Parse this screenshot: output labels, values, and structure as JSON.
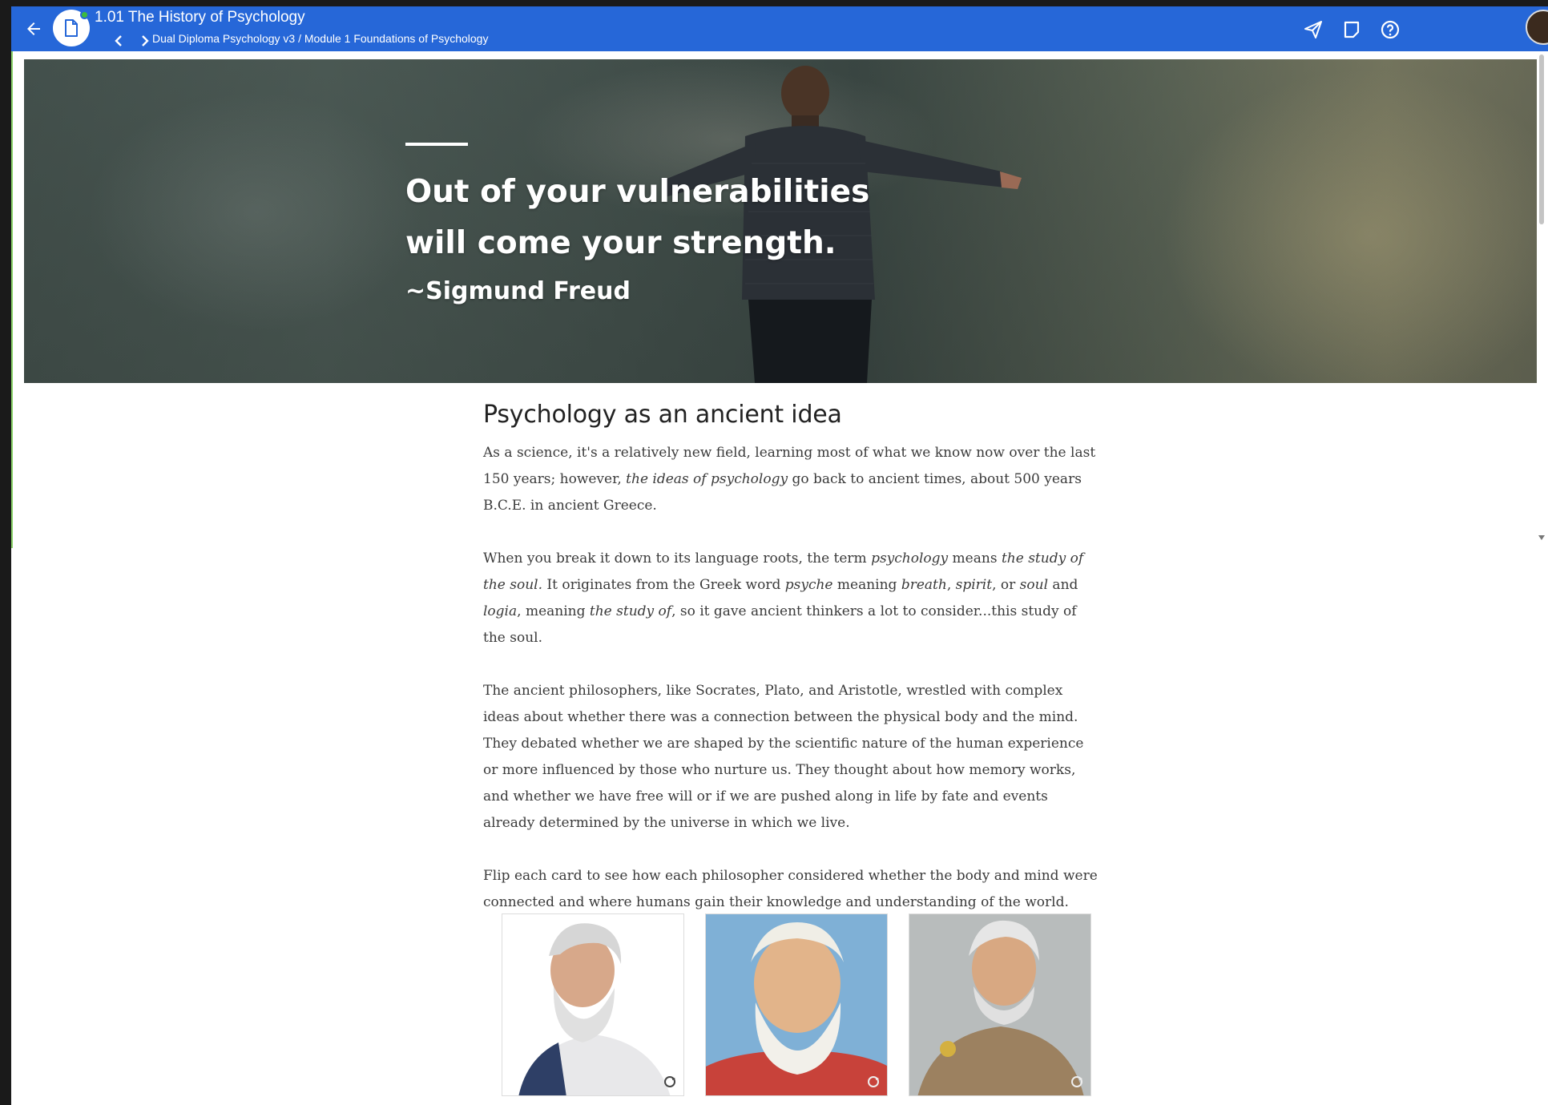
{
  "topbar": {
    "title": "1.01 The History of Psychology",
    "breadcrumb": "Dual Diploma Psychology v3 / Module 1 Foundations of Psychology",
    "accent_color": "#2667d8",
    "icons": [
      "arrow-left-icon",
      "document-icon",
      "chevron-left-icon",
      "chevron-right-icon",
      "send-icon",
      "notes-icon",
      "help-icon"
    ]
  },
  "hero": {
    "quote_line1": "Out of your vulnerabilities",
    "quote_line2": "will come your strength.",
    "author": "~Sigmund Freud"
  },
  "article": {
    "heading": "Psychology as an ancient idea",
    "p1": {
      "a": "As a science, it's a relatively new field, learning most of what we know now over the last 150 years; however, ",
      "b": "the ideas of psychology",
      "c": " go back to ancient times, about 500 years B.C.E. in ancient Greece."
    },
    "p2": {
      "a": "When you break it down to its language roots, the term ",
      "b": "psychology",
      "c": " means ",
      "d": "the study of the soul.",
      "e": "  It originates from the Greek word ",
      "f": "psyche",
      "g": " meaning ",
      "h": "breath",
      "i": ", ",
      "j": "spirit",
      "k": ", or ",
      "l": "soul",
      "m": " and ",
      "n": "logia",
      "o": ", meaning ",
      "p": "the study of",
      "q": ", so it gave ancient thinkers a lot to consider...this study of the soul."
    },
    "p3": "The ancient philosophers, like Socrates, Plato, and Aristotle, wrestled with complex ideas about whether there was a connection between the physical body and the mind. They debated whether we are shaped by the scientific nature of the human experience or more influenced by those who nurture us. They thought about how memory works, and whether we have free will or if we are pushed along in life by fate and events already determined by the universe in which we live.",
    "p4": "Flip each card to see how each philosopher considered whether the body and mind were connected and where humans gain their knowledge and understanding of the world."
  },
  "cards": [
    {
      "icon": "socrates-portrait",
      "background": "#ffffff"
    },
    {
      "icon": "plato-portrait",
      "background": "#7fb0d6"
    },
    {
      "icon": "aristotle-portrait",
      "background": "#b8bcbc"
    }
  ]
}
